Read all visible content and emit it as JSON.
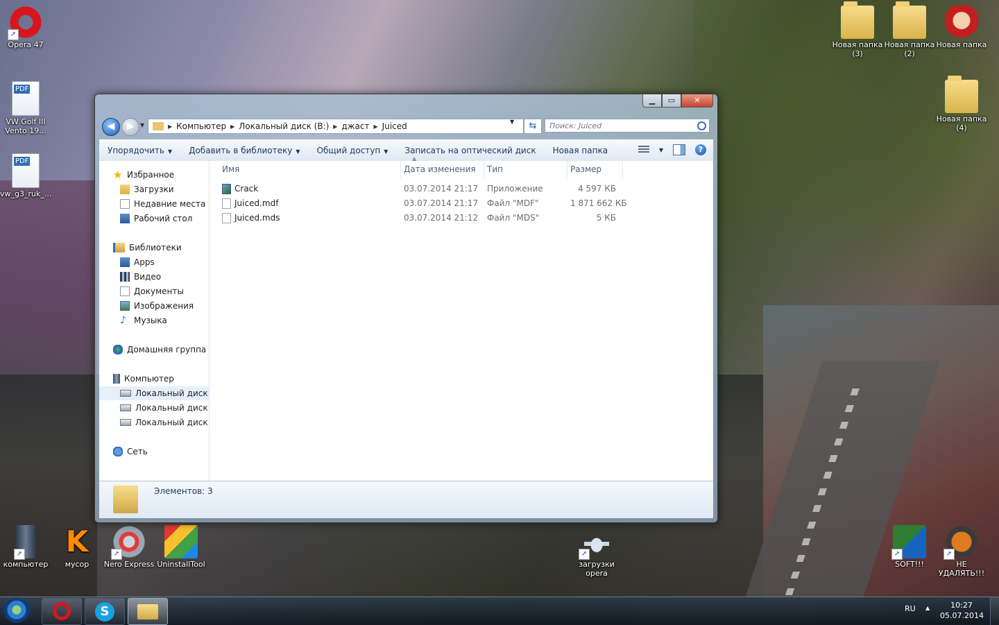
{
  "desktop": {
    "icons": [
      {
        "label": "Opera 47"
      },
      {
        "label": "VW Golf III Vento 19..."
      },
      {
        "label": "vw_g3_ruk_..."
      },
      {
        "label": "Новая папка (3)"
      },
      {
        "label": "Новая папка (2)"
      },
      {
        "label": "Новая папка"
      },
      {
        "label": "Новая папка (4)"
      },
      {
        "label": "компьютер"
      },
      {
        "label": "мусор"
      },
      {
        "label": "Nero Express"
      },
      {
        "label": "UninstallTool"
      },
      {
        "label": "загрузки opera"
      },
      {
        "label": "SOFT!!!"
      },
      {
        "label": "НЕ УДАЛЯТЬ!!!"
      }
    ]
  },
  "window": {
    "caption_buttons": {
      "minimize": "▁",
      "maximize": "▭",
      "close": "✕"
    },
    "address": {
      "segments": [
        "Компьютер",
        "Локальный диск (B:)",
        "джаст",
        "Juiced"
      ]
    },
    "search": {
      "placeholder": "Поиск: Juiced"
    },
    "toolbar": {
      "organize": "Упорядочить",
      "add_to_library": "Добавить в библиотеку",
      "share": "Общий доступ",
      "burn": "Записать на оптический диск",
      "new_folder": "Новая папка"
    },
    "nav": {
      "favorites": "Избранное",
      "downloads": "Загрузки",
      "recent": "Недавние места",
      "desktop": "Рабочий стол",
      "libraries": "Библиотеки",
      "apps": "Apps",
      "video": "Видео",
      "documents": "Документы",
      "images": "Изображения",
      "music": "Музыка",
      "homegroup": "Домашняя группа",
      "computer": "Компьютер",
      "drive_b": "Локальный диск (B",
      "drive_c": "Локальный диск (C",
      "drive_d": "Локальный диск (D",
      "network": "Сеть"
    },
    "columns": {
      "name": "Имя",
      "date": "Дата изменения",
      "type": "Тип",
      "size": "Размер"
    },
    "files": [
      {
        "name": "Crack",
        "date": "03.07.2014 21:17",
        "type": "Приложение",
        "size": "4 597 КБ"
      },
      {
        "name": "Juiced.mdf",
        "date": "03.07.2014 21:17",
        "type": "Файл \"MDF\"",
        "size": "1 871 662 КБ"
      },
      {
        "name": "Juiced.mds",
        "date": "03.07.2014 21:12",
        "type": "Файл \"MDS\"",
        "size": "5 КБ"
      }
    ],
    "details": {
      "count": "Элементов: 3"
    }
  },
  "taskbar": {
    "lang": "RU",
    "time": "10:27",
    "date": "05.07.2014"
  }
}
